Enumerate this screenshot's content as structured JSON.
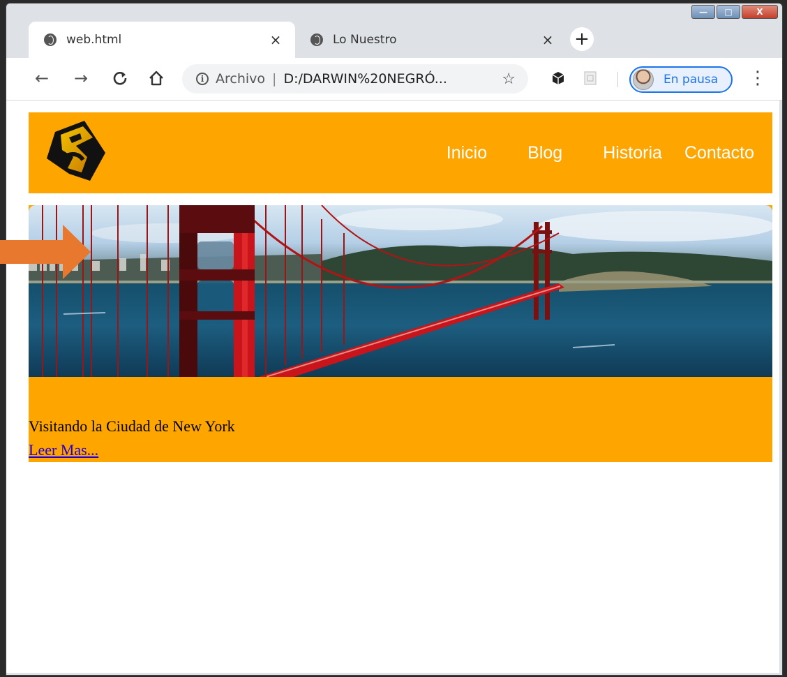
{
  "browser": {
    "tabs": [
      {
        "title": "web.html",
        "active": true
      },
      {
        "title": "Lo Nuestro",
        "active": false
      }
    ],
    "address": {
      "scheme_label": "Archivo",
      "separator": "|",
      "url": "D:/DARWIN%20NEGRÓ..."
    },
    "profile_label": "En pausa",
    "window_controls": {
      "minimize": "—",
      "maximize": "□",
      "close": "X"
    }
  },
  "page": {
    "nav": [
      "Inicio",
      "Blog",
      "Historia",
      "Contacto"
    ],
    "caption": "Visitando la Ciudad de New York",
    "read_more": "Leer Mas..."
  },
  "colors": {
    "header_bg": "#ffa500",
    "nav_text": "#ffffff",
    "link": "#2400d6",
    "annotation_arrow": "#e8782e",
    "bridge": "#c8141a"
  },
  "icons": [
    "back-icon",
    "forward-icon",
    "reload-icon",
    "home-icon",
    "info-icon",
    "star-icon",
    "extension-cube-icon",
    "extension-page-icon",
    "menu-dots-icon",
    "globe-icon",
    "close-tab-icon",
    "new-tab-icon"
  ]
}
